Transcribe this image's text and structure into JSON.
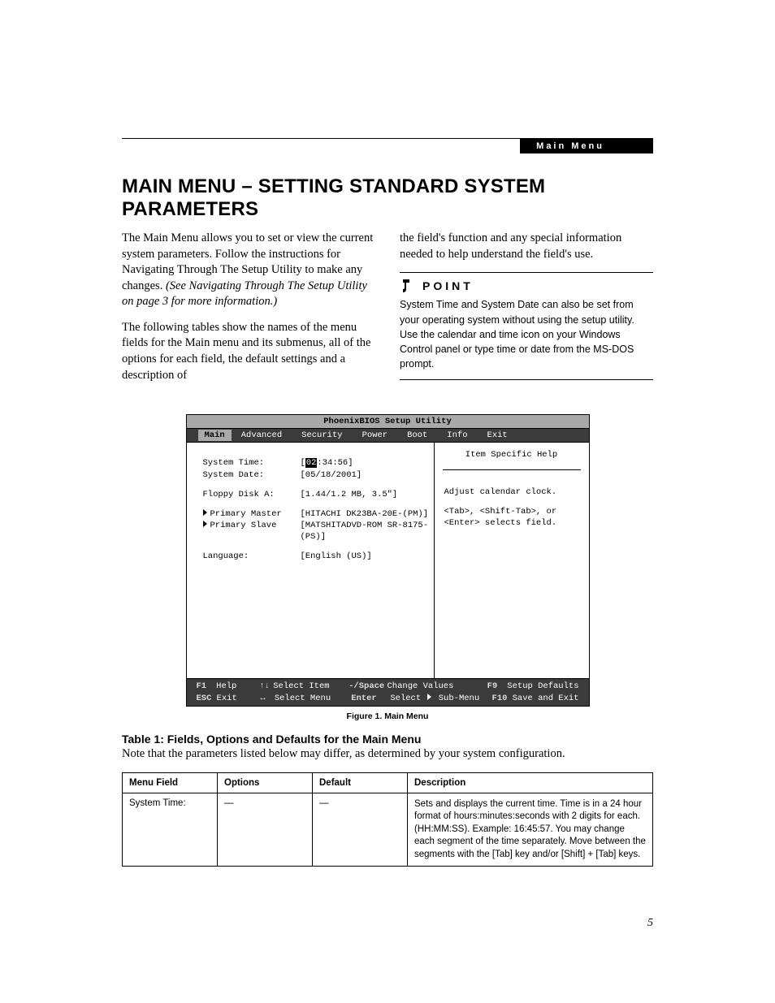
{
  "header": {
    "tab": "Main Menu"
  },
  "title": "MAIN MENU – SETTING STANDARD SYSTEM PARAMETERS",
  "intro": {
    "p1": "The Main Menu allows you to set or view the current system parameters. Follow the instructions for Navigating Through The Setup Utility to make any changes.",
    "p1_ital": "(See Navigating Through The Setup Utility on page 3 for more information.)",
    "p2": "The following tables show the names of the menu fields for the Main menu and its submenus, all of the options for each field, the default settings and a description of",
    "p3": "the field's function and any special information needed to help understand the field's use."
  },
  "point": {
    "label": "POINT",
    "text": "System Time and System Date can also be set from your operating system without using the setup utility. Use the calendar and time icon on your Windows Control panel or type time or date from the MS-DOS prompt."
  },
  "bios": {
    "title": "PhoenixBIOS Setup Utility",
    "menu": [
      "Main",
      "Advanced",
      "Security",
      "Power",
      "Boot",
      "Info",
      "Exit"
    ],
    "selected_menu": "Main",
    "fields": {
      "system_time": {
        "label": "System Time:",
        "value_pre": "[",
        "value_cursor": "02",
        "value_post": ":34:56]"
      },
      "system_date": {
        "label": "System Date:",
        "value": "[05/18/2001]"
      },
      "floppy": {
        "label": "Floppy Disk A:",
        "value": "[1.44/1.2 MB, 3.5\"]"
      },
      "primary_master": {
        "label": "Primary Master",
        "value": "[HITACHI DK23BA-20E-(PM)]"
      },
      "primary_slave": {
        "label": "Primary Slave",
        "value": "[MATSHITADVD-ROM SR-8175-(PS)]"
      },
      "language": {
        "label": "Language:",
        "value": "[English (US)]"
      }
    },
    "help": {
      "title": "Item Specific Help",
      "line1": "Adjust calendar clock.",
      "line2": "<Tab>, <Shift-Tab>, or <Enter> selects field."
    },
    "footer": {
      "f1": "F1",
      "help": "Help",
      "select_item": "Select Item",
      "minus_space": "-/Space",
      "change_values": "Change Values",
      "f9": "F9",
      "setup_defaults": "Setup Defaults",
      "esc": "ESC",
      "exit": "Exit",
      "select_menu": "Select Menu",
      "enter": "Enter",
      "select_submenu": "Select    Sub-Menu",
      "f10": "F10",
      "save_exit": "Save and Exit"
    }
  },
  "figure_caption": "Figure 1.  Main Menu",
  "table": {
    "title": "Table 1: Fields, Options and Defaults for the Main Menu",
    "note": "Note that the parameters listed below may differ, as determined by your system configuration.",
    "headers": {
      "menu_field": "Menu Field",
      "options": "Options",
      "default": "Default",
      "description": "Description"
    },
    "rows": [
      {
        "menu_field": "System Time:",
        "options": "—",
        "default": "—",
        "description": "Sets and displays the current time. Time is in a 24 hour format of hours:minutes:seconds with 2 digits for each. (HH:MM:SS). Example: 16:45:57. You may change each segment of the time separately. Move between the segments with the [Tab] key and/or [Shift] + [Tab] keys."
      }
    ]
  },
  "page_number": "5"
}
